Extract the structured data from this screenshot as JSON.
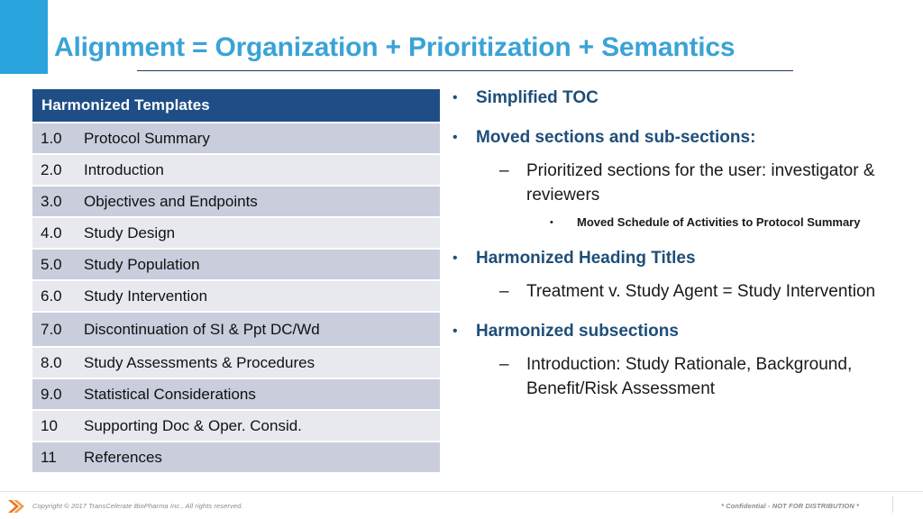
{
  "slide": {
    "title": "Alignment = Organization + Prioritization + Semantics",
    "accent_color": "#29a3dc",
    "title_color": "#3aa3d6",
    "header_fill": "#1f4e87",
    "row_dark": "#c9cddc",
    "row_light": "#e7e9ee",
    "bullet_color": "#1f4e79"
  },
  "toc": {
    "header": "Harmonized Templates",
    "rows": [
      {
        "num": "1.0",
        "label": "Protocol Summary"
      },
      {
        "num": "2.0",
        "label": "Introduction"
      },
      {
        "num": "3.0",
        "label": "Objectives and Endpoints"
      },
      {
        "num": "4.0",
        "label": "Study Design"
      },
      {
        "num": "5.0",
        "label": "Study Population"
      },
      {
        "num": "6.0",
        "label": "Study Intervention"
      },
      {
        "num": "7.0",
        "label": "Discontinuation of SI & Ppt DC/Wd"
      },
      {
        "num": "8.0",
        "label": "Study Assessments & Procedures"
      },
      {
        "num": "9.0",
        "label": "Statistical Considerations"
      },
      {
        "num": "10",
        "label": "Supporting Doc & Oper. Consid."
      },
      {
        "num": "11",
        "label": "References"
      }
    ]
  },
  "bullets": [
    {
      "level": 1,
      "mark": "•",
      "text": "Simplified TOC"
    },
    {
      "level": 1,
      "mark": "•",
      "text": "Moved sections and sub-sections:"
    },
    {
      "level": 2,
      "mark": "–",
      "text": "Prioritized sections for the user: investigator & reviewers"
    },
    {
      "level": 3,
      "mark": "•",
      "text": "Moved Schedule of Activities to Protocol Summary"
    },
    {
      "level": 1,
      "mark": "•",
      "text": "Harmonized Heading Titles"
    },
    {
      "level": 2,
      "mark": "–",
      "text": "Treatment v. Study Agent = Study Intervention"
    },
    {
      "level": 1,
      "mark": "•",
      "text": "Harmonized subsections"
    },
    {
      "level": 2,
      "mark": "–",
      "text": "Introduction: Study Rationale, Background, Benefit/Risk Assessment"
    }
  ],
  "footer": {
    "copyright": "Copyright © 2017 TransCelerate BioPharma Inc., All rights reserved.",
    "confidential": "* Confidential - NOT FOR DISTRIBUTION *",
    "logo_color": "#e8761f"
  }
}
